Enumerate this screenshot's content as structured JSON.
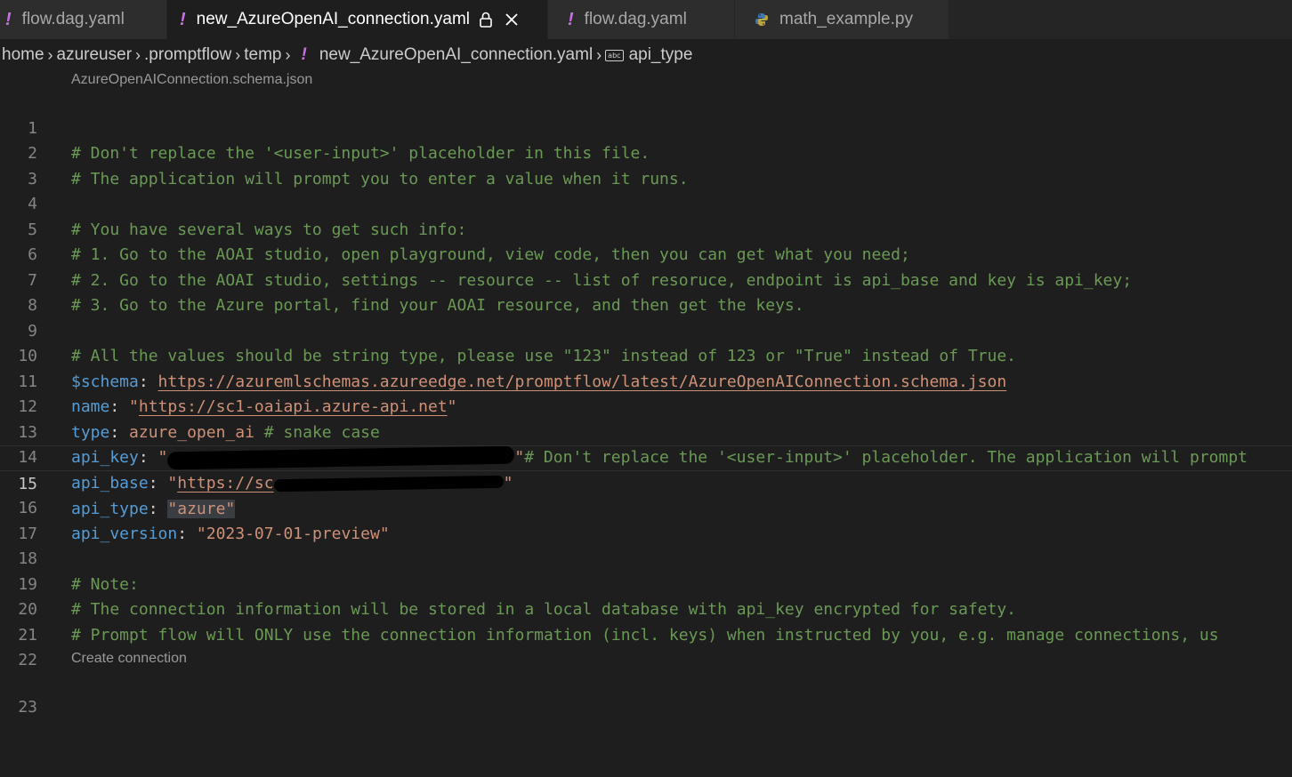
{
  "tabs": [
    {
      "label": "flow.dag.yaml",
      "icon": "yaml-exclamation-icon"
    },
    {
      "label": "new_AzureOpenAI_connection.yaml",
      "icon": "yaml-exclamation-icon",
      "active": true
    },
    {
      "label": "flow.dag.yaml",
      "icon": "yaml-exclamation-icon"
    },
    {
      "label": "math_example.py",
      "icon": "python-icon"
    }
  ],
  "breadcrumb": {
    "items": [
      "home",
      "azureuser",
      ".promptflow",
      "temp",
      "new_AzureOpenAI_connection.yaml"
    ],
    "symbol": "api_type",
    "symbol_icon_text": "abc"
  },
  "codelens": {
    "schema": "AzureOpenAIConnection.schema.json",
    "create": "Create connection"
  },
  "editor": {
    "current_line": 15,
    "line_numbers": [
      "1",
      "2",
      "3",
      "4",
      "5",
      "6",
      "7",
      "8",
      "9",
      "10",
      "11",
      "12",
      "13",
      "14",
      "15",
      "16",
      "17",
      "18",
      "19",
      "20",
      "21",
      "22",
      "23"
    ],
    "lines": {
      "l1": "# Don't replace the '<user-input>' placeholder in this file.",
      "l2": "# The application will prompt you to enter a value when it runs.",
      "l4": "# You have several ways to get such info:",
      "l5": "# 1. Go to the AOAI studio, open playground, view code, then you can get what you need;",
      "l6": "# 2. Go to the AOAI studio, settings -- resource -- list of resoruce, endpoint is api_base and key is api_key;",
      "l7": "# 3. Go to the Azure portal, find your AOAI resource, and then get the keys.",
      "l9": "# All the values should be string type, please use \"123\" instead of 123 or \"True\" instead of True.",
      "l10_key": "$schema",
      "l10_val": "https://azuremlschemas.azureedge.net/promptflow/latest/AzureOpenAIConnection.schema.json",
      "l11_key": "name",
      "l11_val": "https://sc1-oaiapi.azure-api.net",
      "l12_key": "type",
      "l12_val": "azure_open_ai",
      "l12_comment": "# snake case",
      "l13_key": "api_key",
      "l13_comment": "# Don't replace the '<user-input>' placeholder. The application will prompt",
      "l14_key": "api_base",
      "l14_val": "https://sc",
      "l15_key": "api_type",
      "l15_val": "azure",
      "l16_key": "api_version",
      "l16_val": "2023-07-01-preview",
      "l18": "# Note:",
      "l19": "# The connection information will be stored in a local database with api_key encrypted for safety.",
      "l20": "# Prompt flow will ONLY use the connection information (incl. keys) when instructed by you, e.g. manage connections, us"
    }
  },
  "colors": {
    "comment": "#6a9955",
    "key": "#569cd6",
    "string": "#ce9178",
    "background": "#1e1e1e",
    "yaml_icon": "#cc6ee9"
  }
}
